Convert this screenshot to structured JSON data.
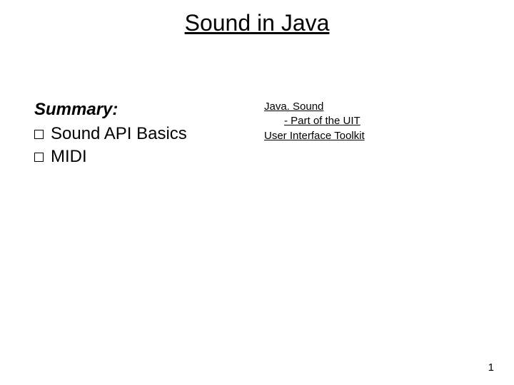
{
  "title": "Sound in Java",
  "left": {
    "summary_label": "Summary:",
    "bullets": [
      "Sound API Basics",
      "MIDI"
    ]
  },
  "right": {
    "line1": "Java. Sound",
    "line2": "- Part of the UIT",
    "line3": "User Interface Toolkit"
  },
  "page_number": "1"
}
